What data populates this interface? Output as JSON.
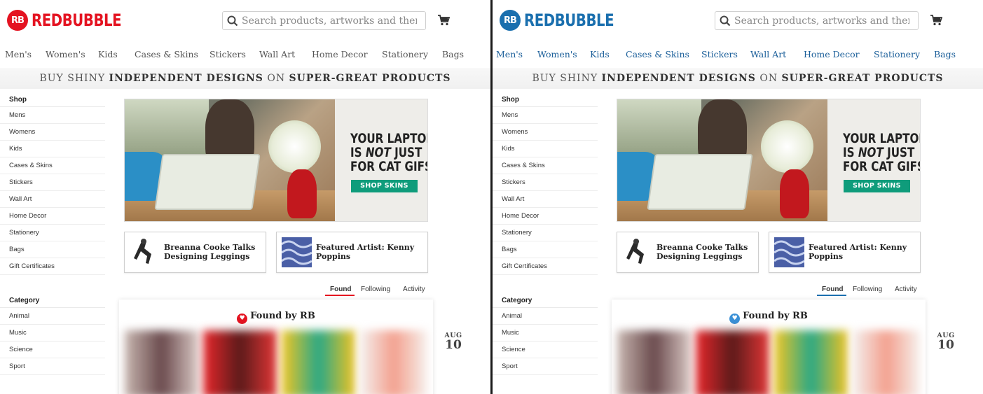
{
  "panels": [
    {
      "id": "left",
      "logo": {
        "text": "REDBUBBLE",
        "mark": "RB",
        "color": "#e41321"
      },
      "accent": "#e41321",
      "nav_color": "#555555",
      "heart_icon": "heart-icon",
      "heart_color": "#e41321"
    },
    {
      "id": "right",
      "logo": {
        "text": "REDBUBBLE",
        "mark": "RB",
        "color": "#1a6fae"
      },
      "accent": "#1a6fae",
      "nav_color": "#1a5e99",
      "heart_icon": "heart-icon",
      "heart_color": "#3a90d6"
    }
  ],
  "search": {
    "placeholder": "Search products, artworks and themes"
  },
  "nav": [
    "Men's",
    "Women's",
    "Kids",
    "Cases & Skins",
    "Stickers",
    "Wall Art",
    "Home Decor",
    "Stationery",
    "Bags"
  ],
  "tagline": {
    "a": "BUY SHINY ",
    "b": "INDEPENDENT DESIGNS",
    "c": " ON ",
    "d": "SUPER-GREAT PRODUCTS"
  },
  "sidebar": {
    "shop_title": "Shop",
    "shop_items": [
      "Mens",
      "Womens",
      "Kids",
      "Cases & Skins",
      "Stickers",
      "Wall Art",
      "Home Decor",
      "Stationery",
      "Bags",
      "Gift Certificates"
    ],
    "category_title": "Category",
    "category_items": [
      "Animal",
      "Music",
      "Science",
      "Sport"
    ]
  },
  "hero": {
    "line1": "YOUR LAPTOP",
    "line2a": "IS ",
    "line2b": "NOT",
    "line2c": " JUST",
    "line3": "FOR CAT GIFS.",
    "button": "SHOP SKINS",
    "button_color": "#0f9c7b"
  },
  "cards": [
    {
      "line1": "Breanna Cooke Talks",
      "line2": "Designing Leggings"
    },
    {
      "line1": "Featured Artist: Kenny",
      "line2": "Poppins"
    }
  ],
  "tabs": [
    "Found",
    "Following",
    "Activity"
  ],
  "found": {
    "title": "Found by RB"
  },
  "date": {
    "month": "AUG",
    "day": "10"
  }
}
